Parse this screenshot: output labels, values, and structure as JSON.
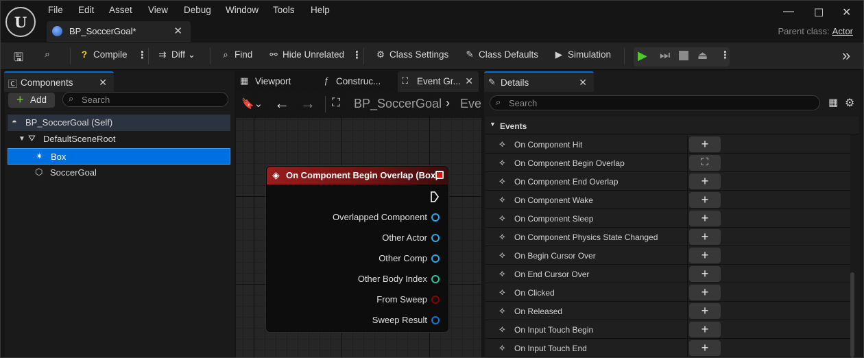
{
  "app": {
    "menu": [
      "File",
      "Edit",
      "Asset",
      "View",
      "Debug",
      "Window",
      "Tools",
      "Help"
    ],
    "document_tab": "BP_SoccerGoal*",
    "parent_class_label": "Parent class:",
    "parent_class_value": "Actor"
  },
  "toolbar": {
    "compile": "Compile",
    "diff": "Diff",
    "find": "Find",
    "hide_unrelated": "Hide Unrelated",
    "class_settings": "Class Settings",
    "class_defaults": "Class Defaults",
    "simulation": "Simulation"
  },
  "components": {
    "tab_label": "Components",
    "add_label": "Add",
    "search_placeholder": "Search",
    "tree": [
      {
        "label": "BP_SoccerGoal (Self)",
        "icon": "actor-icon"
      },
      {
        "label": "DefaultSceneRoot",
        "icon": "scene-root-icon"
      },
      {
        "label": "Box",
        "icon": "box-collision-icon",
        "selected": true
      },
      {
        "label": "SoccerGoal",
        "icon": "static-mesh-icon"
      }
    ]
  },
  "editor_tabs": {
    "viewport": "Viewport",
    "construction": "Construc...",
    "event_graph": "Event Gr..."
  },
  "graph": {
    "breadcrumb": "BP_SoccerGoal",
    "breadcrumb_next": "Eve",
    "node": {
      "title": "On Component Begin Overlap (Box)",
      "pins": [
        {
          "label": "Overlapped Component",
          "color": "#2aa8e8"
        },
        {
          "label": "Other Actor",
          "color": "#2aa8e8"
        },
        {
          "label": "Other Comp",
          "color": "#2aa8e8"
        },
        {
          "label": "Other Body Index",
          "color": "#1fc7a0"
        },
        {
          "label": "From Sweep",
          "color": "#8a0000"
        },
        {
          "label": "Sweep Result",
          "color": "#0a7ad8"
        }
      ]
    }
  },
  "details": {
    "tab_label": "Details",
    "search_placeholder": "Search",
    "section": "Events",
    "events": [
      {
        "label": "On Component Hit",
        "button": "+"
      },
      {
        "label": "On Component Begin Overlap",
        "button": "go-to"
      },
      {
        "label": "On Component End Overlap",
        "button": "+"
      },
      {
        "label": "On Component Wake",
        "button": "+"
      },
      {
        "label": "On Component Sleep",
        "button": "+"
      },
      {
        "label": "On Component Physics State Changed",
        "button": "+"
      },
      {
        "label": "On Begin Cursor Over",
        "button": "+"
      },
      {
        "label": "On End Cursor Over",
        "button": "+"
      },
      {
        "label": "On Clicked",
        "button": "+"
      },
      {
        "label": "On Released",
        "button": "+"
      },
      {
        "label": "On Input Touch Begin",
        "button": "+"
      },
      {
        "label": "On Input Touch End",
        "button": "+"
      }
    ]
  }
}
